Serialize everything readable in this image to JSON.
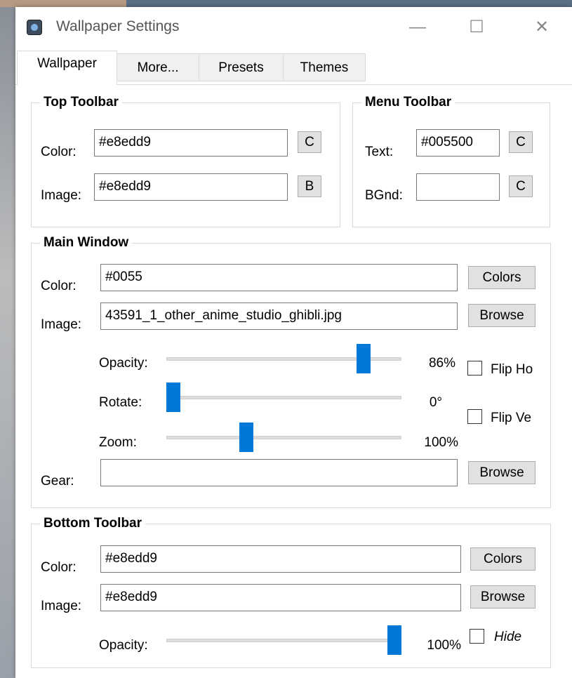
{
  "window": {
    "title": "Wallpaper Settings"
  },
  "title_controls": {
    "minimize": "—",
    "maximize": "☐",
    "close": "✕"
  },
  "tabs": [
    "Wallpaper",
    "More...",
    "Presets",
    "Themes"
  ],
  "top_toolbar": {
    "title": "Top Toolbar",
    "color_label": "Color:",
    "color_value": "#e8edd9",
    "color_button": "C",
    "image_label": "Image:",
    "image_value": "#e8edd9",
    "image_button": "B"
  },
  "menu_toolbar": {
    "title": "Menu Toolbar",
    "text_label": "Text:",
    "text_value": "#005500",
    "text_button": "C",
    "bgnd_label": "BGnd:",
    "bgnd_value": "",
    "bgnd_button": "C"
  },
  "main_window": {
    "title": "Main Window",
    "color_label": "Color:",
    "color_value": "#0055",
    "color_button": "Colors",
    "image_label": "Image:",
    "image_value": "43591_1_other_anime_studio_ghibli.jpg",
    "image_button": "Browse",
    "opacity_label": "Opacity:",
    "opacity_text": "86%",
    "opacity_level": 0.86,
    "rotate_label": "Rotate:",
    "rotate_text": "0°",
    "rotate_level": 0.0,
    "zoom_label": "Zoom:",
    "zoom_text": "100%",
    "zoom_level": 0.33,
    "flip_h_label": "Flip Ho",
    "flip_h_checked": false,
    "flip_v_label": "Flip Ve",
    "flip_v_checked": false,
    "gear_label": "Gear:",
    "gear_value": "",
    "gear_button": "Browse"
  },
  "bottom_toolbar": {
    "title": "Bottom Toolbar",
    "color_label": "Color:",
    "color_value": "#e8edd9",
    "color_button": "Colors",
    "image_label": "Image:",
    "image_value": "#e8edd9",
    "image_button": "Browse",
    "opacity_label": "Opacity:",
    "opacity_text": "100%",
    "opacity_level": 1.0,
    "hide_label": "Hide",
    "hide_checked": false
  },
  "colors": {
    "accent": "#0078d7",
    "window_bg": "#ffffff",
    "button_bg": "#e1e1e1"
  }
}
